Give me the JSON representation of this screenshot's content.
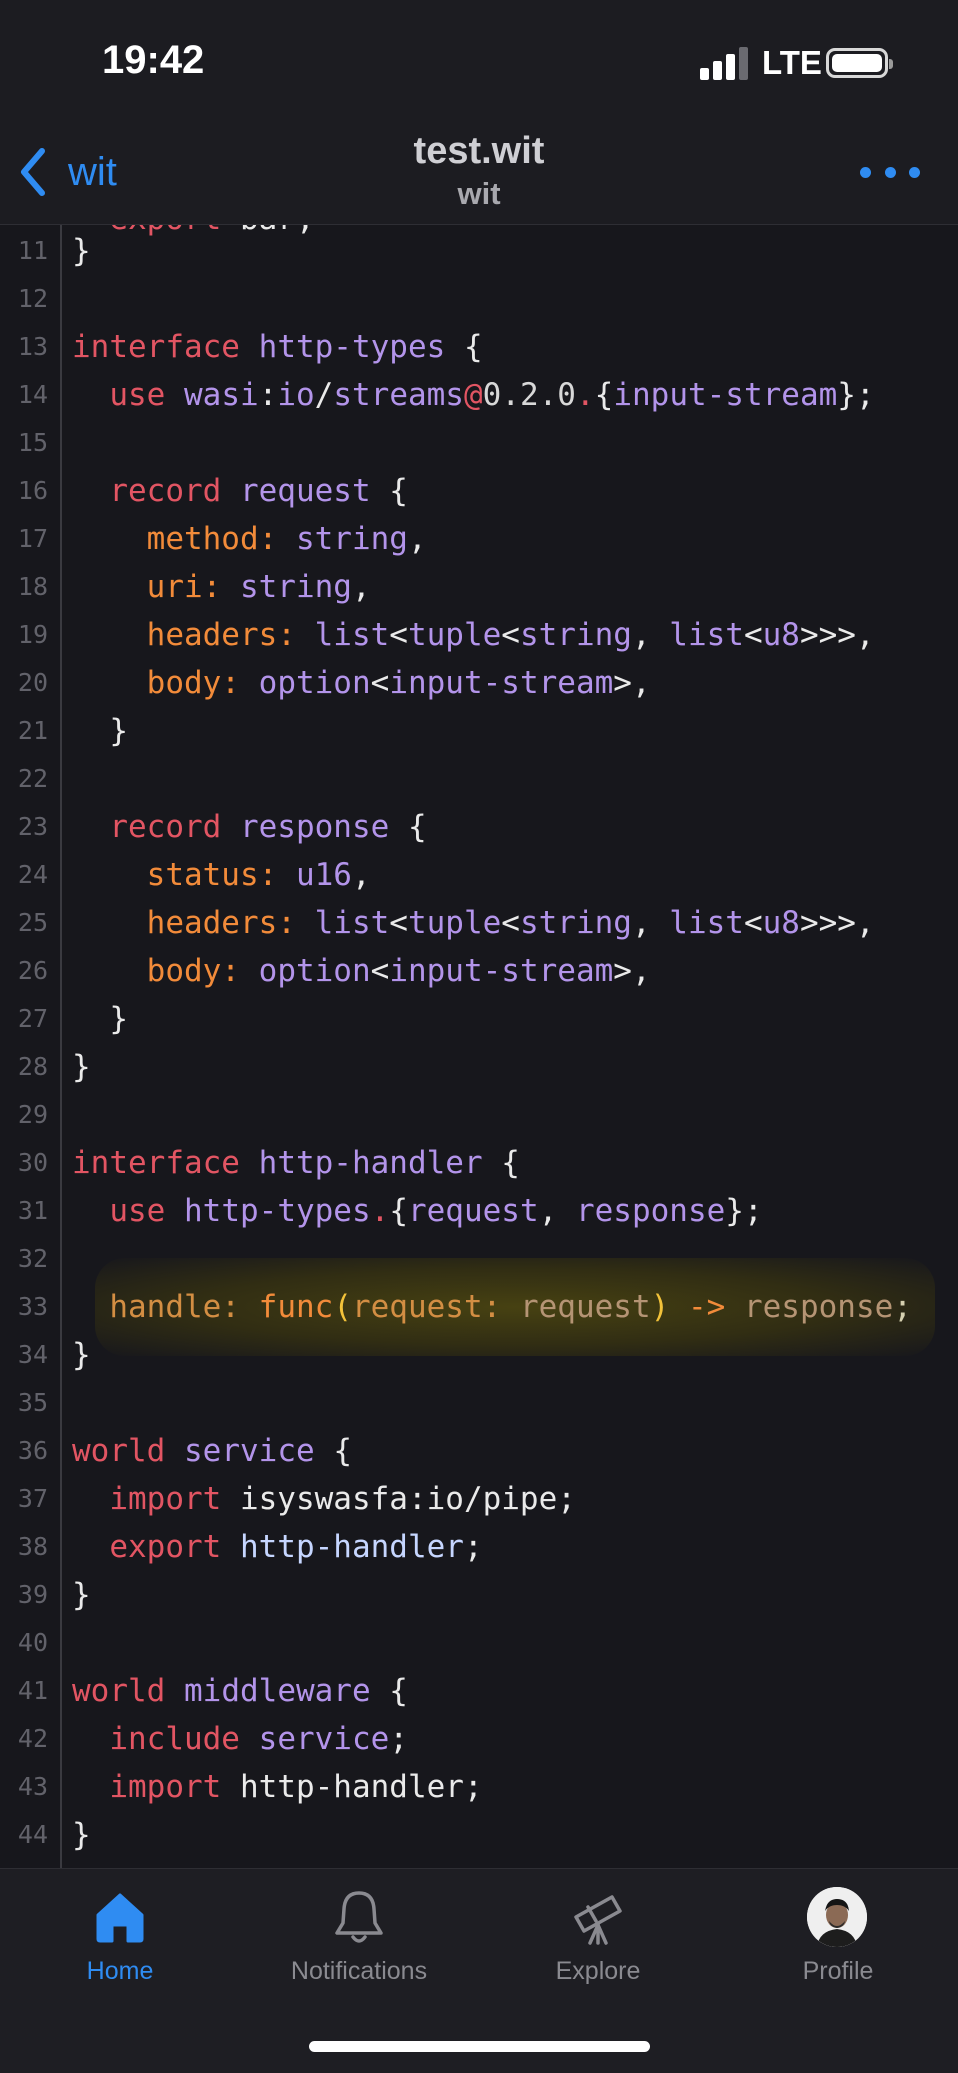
{
  "status_bar": {
    "time": "19:42",
    "carrier": "LTE"
  },
  "nav": {
    "back_label": "wit",
    "title": "test.wit",
    "subtitle": "wit",
    "icons": {
      "back": "chevron-left-icon",
      "more": "more-horizontal-icon"
    }
  },
  "editor": {
    "partial_line_text": "  export bar;",
    "lines": [
      {
        "num": "11",
        "tokens": [
          [
            "}",
            "punct"
          ]
        ]
      },
      {
        "num": "12",
        "tokens": []
      },
      {
        "num": "13",
        "tokens": [
          [
            "interface",
            "kw"
          ],
          [
            " ",
            "punct"
          ],
          [
            "http-types",
            "type"
          ],
          [
            " {",
            "punct"
          ]
        ]
      },
      {
        "num": "14",
        "tokens": [
          [
            "  ",
            "punct"
          ],
          [
            "use",
            "kw"
          ],
          [
            " ",
            "punct"
          ],
          [
            "wasi",
            "type"
          ],
          [
            ":",
            "punct"
          ],
          [
            "io",
            "type"
          ],
          [
            "/",
            "punct"
          ],
          [
            "streams",
            "type"
          ],
          [
            "@",
            "at"
          ],
          [
            "0.2.0",
            "num"
          ],
          [
            ".",
            "at"
          ],
          [
            "{",
            "punct"
          ],
          [
            "input-stream",
            "type"
          ],
          [
            "};",
            "punct"
          ]
        ]
      },
      {
        "num": "15",
        "tokens": []
      },
      {
        "num": "16",
        "tokens": [
          [
            "  ",
            "punct"
          ],
          [
            "record",
            "kw"
          ],
          [
            " ",
            "punct"
          ],
          [
            "request",
            "type"
          ],
          [
            " {",
            "punct"
          ]
        ]
      },
      {
        "num": "17",
        "tokens": [
          [
            "    ",
            "punct"
          ],
          [
            "method:",
            "field"
          ],
          [
            " ",
            "punct"
          ],
          [
            "string",
            "type"
          ],
          [
            ",",
            "punct"
          ]
        ]
      },
      {
        "num": "18",
        "tokens": [
          [
            "    ",
            "punct"
          ],
          [
            "uri:",
            "field"
          ],
          [
            " ",
            "punct"
          ],
          [
            "string",
            "type"
          ],
          [
            ",",
            "punct"
          ]
        ]
      },
      {
        "num": "19",
        "tokens": [
          [
            "    ",
            "punct"
          ],
          [
            "headers:",
            "field"
          ],
          [
            " ",
            "punct"
          ],
          [
            "list",
            "type"
          ],
          [
            "<",
            "punct"
          ],
          [
            "tuple",
            "type"
          ],
          [
            "<",
            "punct"
          ],
          [
            "string",
            "type"
          ],
          [
            ", ",
            "punct"
          ],
          [
            "list",
            "type"
          ],
          [
            "<",
            "punct"
          ],
          [
            "u8",
            "type"
          ],
          [
            ">>>,",
            "punct"
          ]
        ]
      },
      {
        "num": "20",
        "tokens": [
          [
            "    ",
            "punct"
          ],
          [
            "body:",
            "field"
          ],
          [
            " ",
            "punct"
          ],
          [
            "option",
            "type"
          ],
          [
            "<",
            "punct"
          ],
          [
            "input-stream",
            "type"
          ],
          [
            ">,",
            "punct"
          ]
        ]
      },
      {
        "num": "21",
        "tokens": [
          [
            "  }",
            "punct"
          ]
        ]
      },
      {
        "num": "22",
        "tokens": []
      },
      {
        "num": "23",
        "tokens": [
          [
            "  ",
            "punct"
          ],
          [
            "record",
            "kw"
          ],
          [
            " ",
            "punct"
          ],
          [
            "response",
            "type"
          ],
          [
            " {",
            "punct"
          ]
        ]
      },
      {
        "num": "24",
        "tokens": [
          [
            "    ",
            "punct"
          ],
          [
            "status:",
            "field"
          ],
          [
            " ",
            "punct"
          ],
          [
            "u16",
            "type"
          ],
          [
            ",",
            "punct"
          ]
        ]
      },
      {
        "num": "25",
        "tokens": [
          [
            "    ",
            "punct"
          ],
          [
            "headers:",
            "field"
          ],
          [
            " ",
            "punct"
          ],
          [
            "list",
            "type"
          ],
          [
            "<",
            "punct"
          ],
          [
            "tuple",
            "type"
          ],
          [
            "<",
            "punct"
          ],
          [
            "string",
            "type"
          ],
          [
            ", ",
            "punct"
          ],
          [
            "list",
            "type"
          ],
          [
            "<",
            "punct"
          ],
          [
            "u8",
            "type"
          ],
          [
            ">>>,",
            "punct"
          ]
        ]
      },
      {
        "num": "26",
        "tokens": [
          [
            "    ",
            "punct"
          ],
          [
            "body:",
            "field"
          ],
          [
            " ",
            "punct"
          ],
          [
            "option",
            "type"
          ],
          [
            "<",
            "punct"
          ],
          [
            "input-stream",
            "type"
          ],
          [
            ">,",
            "punct"
          ]
        ]
      },
      {
        "num": "27",
        "tokens": [
          [
            "  }",
            "punct"
          ]
        ]
      },
      {
        "num": "28",
        "tokens": [
          [
            "}",
            "punct"
          ]
        ]
      },
      {
        "num": "29",
        "tokens": []
      },
      {
        "num": "30",
        "tokens": [
          [
            "interface",
            "kw"
          ],
          [
            " ",
            "punct"
          ],
          [
            "http-handler",
            "type"
          ],
          [
            " {",
            "punct"
          ]
        ]
      },
      {
        "num": "31",
        "tokens": [
          [
            "  ",
            "punct"
          ],
          [
            "use",
            "kw"
          ],
          [
            " ",
            "punct"
          ],
          [
            "http-types",
            "type"
          ],
          [
            ".",
            "at"
          ],
          [
            "{",
            "punct"
          ],
          [
            "request",
            "type"
          ],
          [
            ", ",
            "punct"
          ],
          [
            "response",
            "type"
          ],
          [
            "};",
            "punct"
          ]
        ]
      },
      {
        "num": "32",
        "tokens": []
      },
      {
        "num": "33",
        "highlight": true,
        "tokens": [
          [
            "  ",
            "punct"
          ],
          [
            "handle:",
            "dim-field"
          ],
          [
            " ",
            "punct"
          ],
          [
            "func",
            "field"
          ],
          [
            "(",
            "paren"
          ],
          [
            "request:",
            "dim-field"
          ],
          [
            " ",
            "punct"
          ],
          [
            "request",
            "dim-type"
          ],
          [
            ")",
            "paren"
          ],
          [
            " ",
            "punct"
          ],
          [
            "->",
            "field"
          ],
          [
            " ",
            "punct"
          ],
          [
            "response",
            "dim-type"
          ],
          [
            ";",
            "dim-punct"
          ]
        ]
      },
      {
        "num": "34",
        "tokens": [
          [
            "}",
            "punct"
          ]
        ]
      },
      {
        "num": "35",
        "tokens": []
      },
      {
        "num": "36",
        "tokens": [
          [
            "world",
            "kw"
          ],
          [
            " ",
            "punct"
          ],
          [
            "service",
            "type"
          ],
          [
            " {",
            "punct"
          ]
        ]
      },
      {
        "num": "37",
        "tokens": [
          [
            "  ",
            "punct"
          ],
          [
            "import",
            "kw"
          ],
          [
            " isyswasfa:io/pipe;",
            "punct"
          ]
        ]
      },
      {
        "num": "38",
        "tokens": [
          [
            "  ",
            "punct"
          ],
          [
            "export",
            "kw"
          ],
          [
            " ",
            "punct"
          ],
          [
            "http-handler",
            "ident"
          ],
          [
            ";",
            "punct"
          ]
        ]
      },
      {
        "num": "39",
        "tokens": [
          [
            "}",
            "punct"
          ]
        ]
      },
      {
        "num": "40",
        "tokens": []
      },
      {
        "num": "41",
        "tokens": [
          [
            "world",
            "kw"
          ],
          [
            " ",
            "punct"
          ],
          [
            "middleware",
            "type"
          ],
          [
            " {",
            "punct"
          ]
        ]
      },
      {
        "num": "42",
        "tokens": [
          [
            "  ",
            "punct"
          ],
          [
            "include",
            "kw"
          ],
          [
            " ",
            "punct"
          ],
          [
            "service",
            "type"
          ],
          [
            ";",
            "punct"
          ]
        ]
      },
      {
        "num": "43",
        "tokens": [
          [
            "  ",
            "punct"
          ],
          [
            "import",
            "kw"
          ],
          [
            " http-handler;",
            "punct"
          ]
        ]
      },
      {
        "num": "44",
        "tokens": [
          [
            "}",
            "punct"
          ]
        ]
      }
    ]
  },
  "tab_bar": {
    "tabs": [
      {
        "id": "home",
        "label": "Home",
        "icon": "home-icon",
        "active": true
      },
      {
        "id": "notifications",
        "label": "Notifications",
        "icon": "bell-icon",
        "active": false
      },
      {
        "id": "explore",
        "label": "Explore",
        "icon": "telescope-icon",
        "active": false
      },
      {
        "id": "profile",
        "label": "Profile",
        "icon": "avatar",
        "active": false
      }
    ]
  },
  "colors": {
    "accent": "#2f8cf2",
    "keyword": "#e25563",
    "type": "#b394ea",
    "field": "#f28b3a",
    "background": "#17171c"
  }
}
